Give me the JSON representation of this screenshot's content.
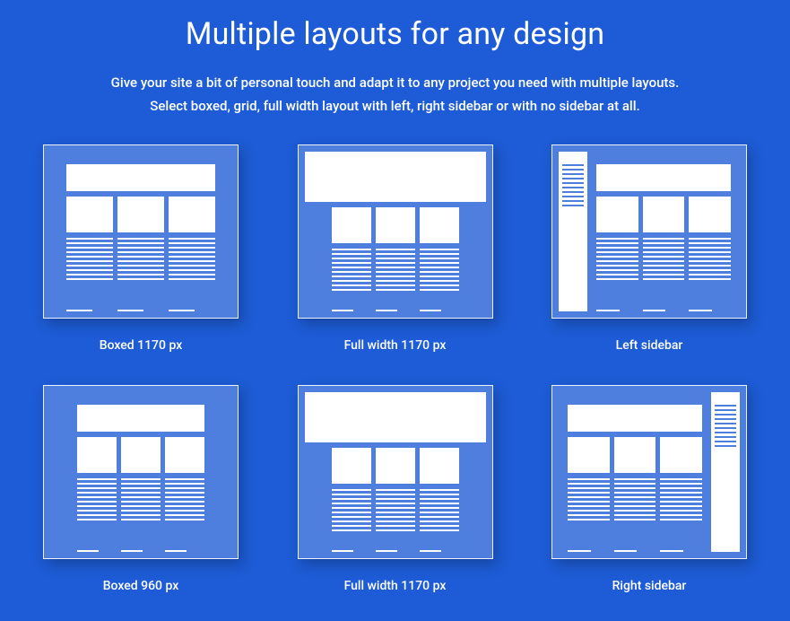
{
  "heading": "Multiple layouts for any design",
  "description_line1": "Give your site a bit of personal touch and adapt it to any project you need with multiple layouts.",
  "description_line2": "Select boxed, grid, full width layout with left, right sidebar or with no sidebar at all.",
  "layouts": [
    {
      "label": "Boxed 1170 px"
    },
    {
      "label": "Full width 1170 px"
    },
    {
      "label": "Left sidebar"
    },
    {
      "label": "Boxed 960 px"
    },
    {
      "label": "Full width 1170 px"
    },
    {
      "label": "Right sidebar"
    }
  ]
}
